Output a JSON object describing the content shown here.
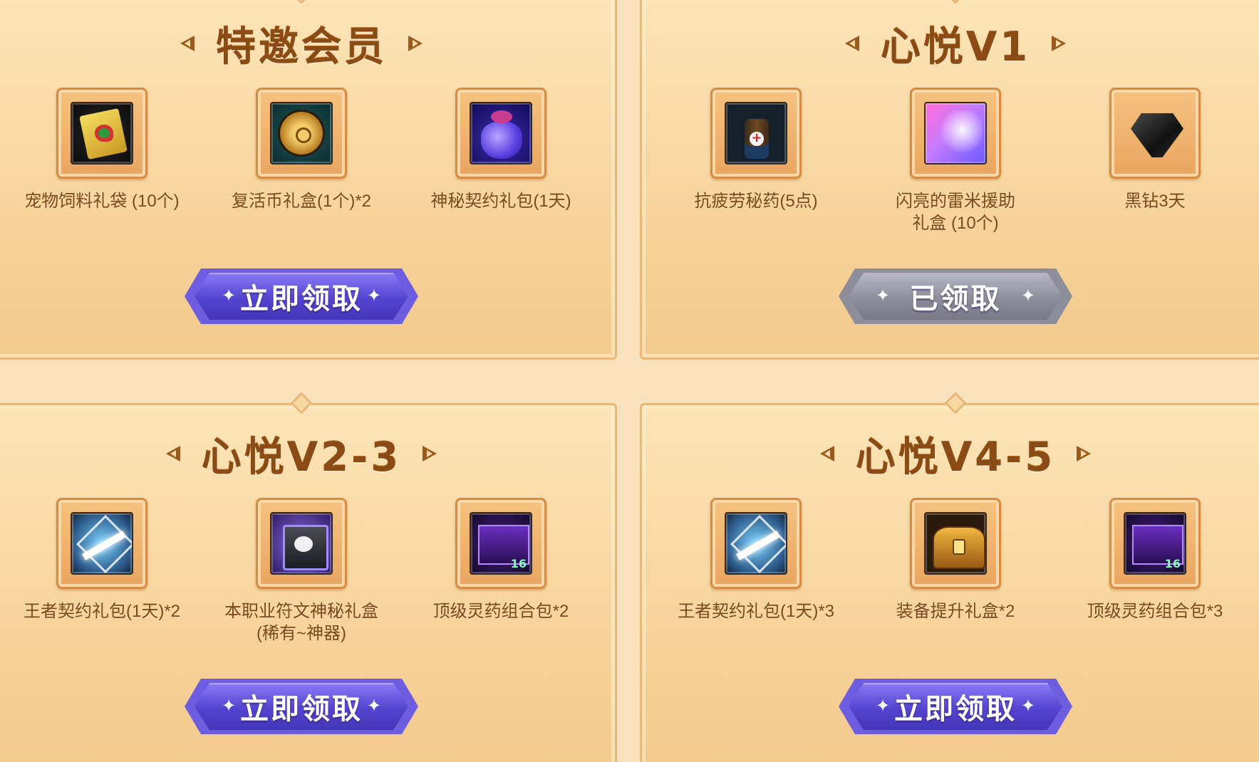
{
  "panels": [
    {
      "title": "特邀会员",
      "items": [
        {
          "label": "宠物饲料礼袋 (10个)",
          "icon": "pet-feed-icon"
        },
        {
          "label": "复活币礼盒(1个)*2",
          "icon": "revive-coin-icon"
        },
        {
          "label": "神秘契约礼包(1天)",
          "icon": "mystery-bag-icon"
        }
      ],
      "button": {
        "label": "立即领取",
        "state": "active"
      }
    },
    {
      "title": "心悦V1",
      "items": [
        {
          "label": "抗疲劳秘药(5点)",
          "icon": "potion-icon"
        },
        {
          "label": "闪亮的雷米援助\n礼盒 (10个)",
          "icon": "remy-box-icon"
        },
        {
          "label": "黑钻3天",
          "icon": "black-diamond-icon"
        }
      ],
      "button": {
        "label": "已领取",
        "state": "claimed"
      }
    },
    {
      "title": "心悦V2-3",
      "items": [
        {
          "label": "王者契约礼包(1天)*2",
          "icon": "king-contract-icon"
        },
        {
          "label": "本职业符文神秘礼盒\n(稀有~神器)",
          "icon": "rune-box-icon"
        },
        {
          "label": "顶级灵药组合包*2",
          "icon": "elixir-pack-icon"
        }
      ],
      "button": {
        "label": "立即领取",
        "state": "active"
      }
    },
    {
      "title": "心悦V4-5",
      "items": [
        {
          "label": "王者契约礼包(1天)*3",
          "icon": "king-contract-icon"
        },
        {
          "label": "装备提升礼盒*2",
          "icon": "gear-box-icon"
        },
        {
          "label": "顶级灵药组合包*3",
          "icon": "elixir-pack-icon"
        }
      ],
      "button": {
        "label": "立即领取",
        "state": "active"
      }
    }
  ],
  "colors": {
    "background": "#f8e2bd",
    "title": "#8a4b14",
    "label": "#7a4a20",
    "button_active": "#5443cf",
    "button_claimed": "#8e8d9b",
    "border": "#e9b879"
  }
}
